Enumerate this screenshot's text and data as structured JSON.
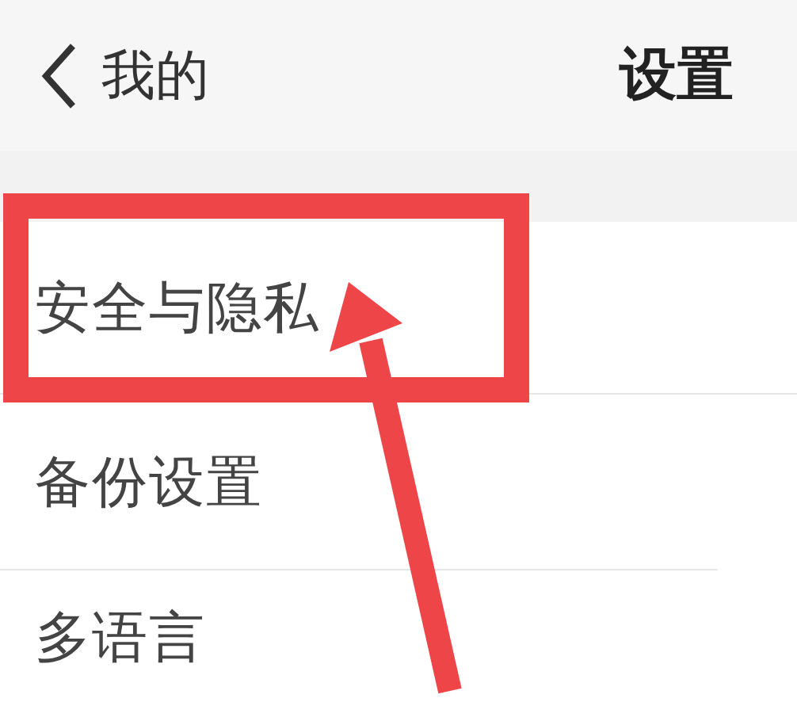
{
  "header": {
    "back_label": "我的",
    "title": "设置"
  },
  "items": [
    {
      "label": "安全与隐私",
      "highlighted": true
    },
    {
      "label": "备份设置",
      "highlighted": false
    },
    {
      "label": "多语言",
      "highlighted": false
    }
  ]
}
